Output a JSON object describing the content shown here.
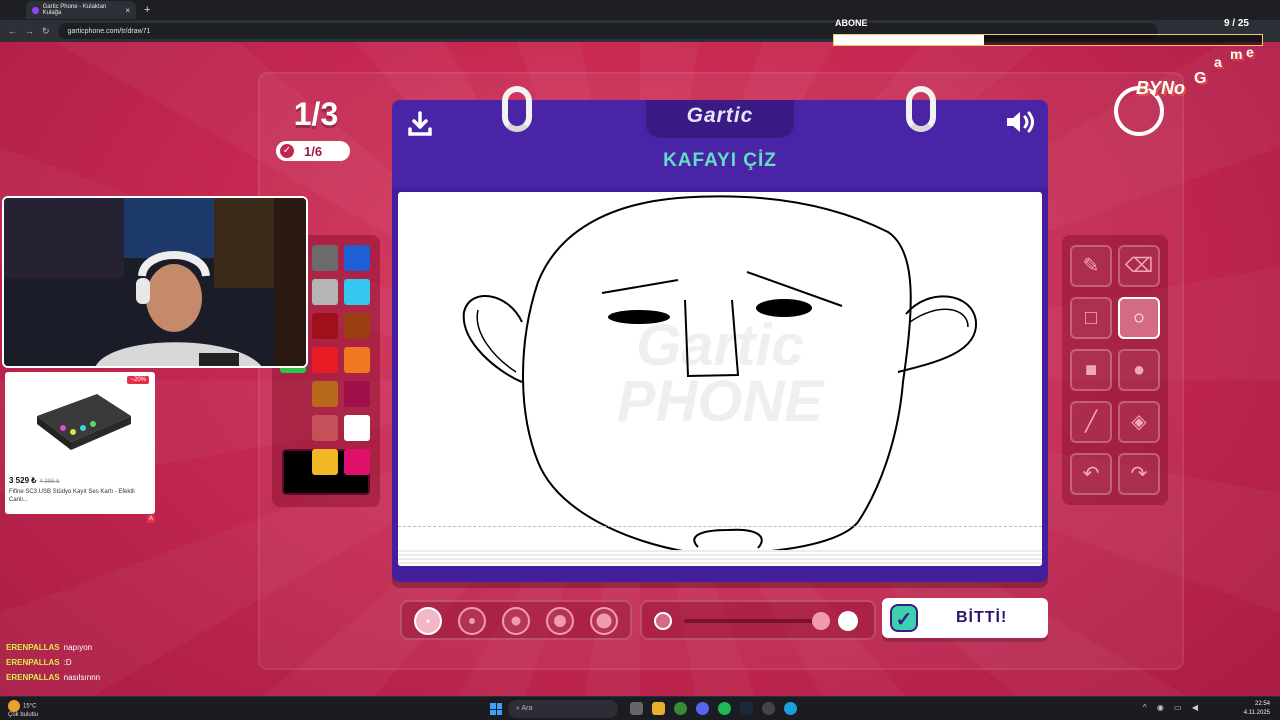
{
  "browser": {
    "tab_title": "Gartic Phone - Kulaktan Kulağa",
    "url": "garticphone.com/tr/draw71"
  },
  "overlay": {
    "abone_label": "ABONE",
    "abone_count": "9 / 25",
    "abone_progress": 0.35,
    "logo_text_1": "BYNo",
    "logo_text_2": "G",
    "logo_text_3": "a",
    "logo_text_4": "m",
    "logo_text_5": "e"
  },
  "game": {
    "round": "1/3",
    "progress": "1/6",
    "logo": "Gartic",
    "prompt": "KAFAYI ÇİZ",
    "watermark_top": "Gartic",
    "watermark_bottom": "PHONE",
    "done_label": "BİTTİ!",
    "current_color": "#000000",
    "palette": [
      "#6b6b6b",
      "#1f5fd6",
      "#b5b5b5",
      "#34c8f0",
      "#a0101a",
      "#9a3e14",
      "#e81c24",
      "#f07a24",
      "#b86a1a",
      "#a0104a",
      "#c4505a",
      "#ffffff",
      "#f2b824",
      "#e0106a",
      "#f4aab4",
      "#000000"
    ],
    "tools": [
      {
        "name": "pencil-tool",
        "icon": "pencil-icon",
        "active": false
      },
      {
        "name": "eraser-tool",
        "icon": "eraser-icon",
        "active": false
      },
      {
        "name": "rectangle-outline-tool",
        "icon": "rectangle-outline-icon",
        "active": false
      },
      {
        "name": "ellipse-outline-tool",
        "icon": "ellipse-outline-icon",
        "active": true
      },
      {
        "name": "rectangle-fill-tool",
        "icon": "rectangle-fill-icon",
        "active": false
      },
      {
        "name": "ellipse-fill-tool",
        "icon": "ellipse-fill-icon",
        "active": false
      },
      {
        "name": "line-tool",
        "icon": "line-icon",
        "active": false
      },
      {
        "name": "bucket-tool",
        "icon": "bucket-icon",
        "active": false
      },
      {
        "name": "undo-tool",
        "icon": "undo-icon",
        "active": false
      },
      {
        "name": "redo-tool",
        "icon": "redo-icon",
        "active": false
      }
    ],
    "brush_sizes": 5,
    "selected_brush_size": 1,
    "opacity_level": 1.0
  },
  "ad": {
    "discount": "−20%",
    "price": "3 529 ₺",
    "old_price": "4 386 ₺",
    "description": "Fifine SC3 USB Stüdyo Kayıt Ses Kartı - Efektli Canlı..."
  },
  "chat": [
    {
      "user": "ERENPALLAS",
      "text": "napıyon"
    },
    {
      "user": "ERENPALLAS",
      "text": ":D"
    },
    {
      "user": "ERENPALLAS",
      "text": "nasılsınnn"
    }
  ],
  "taskbar": {
    "temperature": "15°C",
    "weather": "Çok bulutlu",
    "search_placeholder": "Ara",
    "time": "22:54",
    "date": "4.11.2025"
  }
}
